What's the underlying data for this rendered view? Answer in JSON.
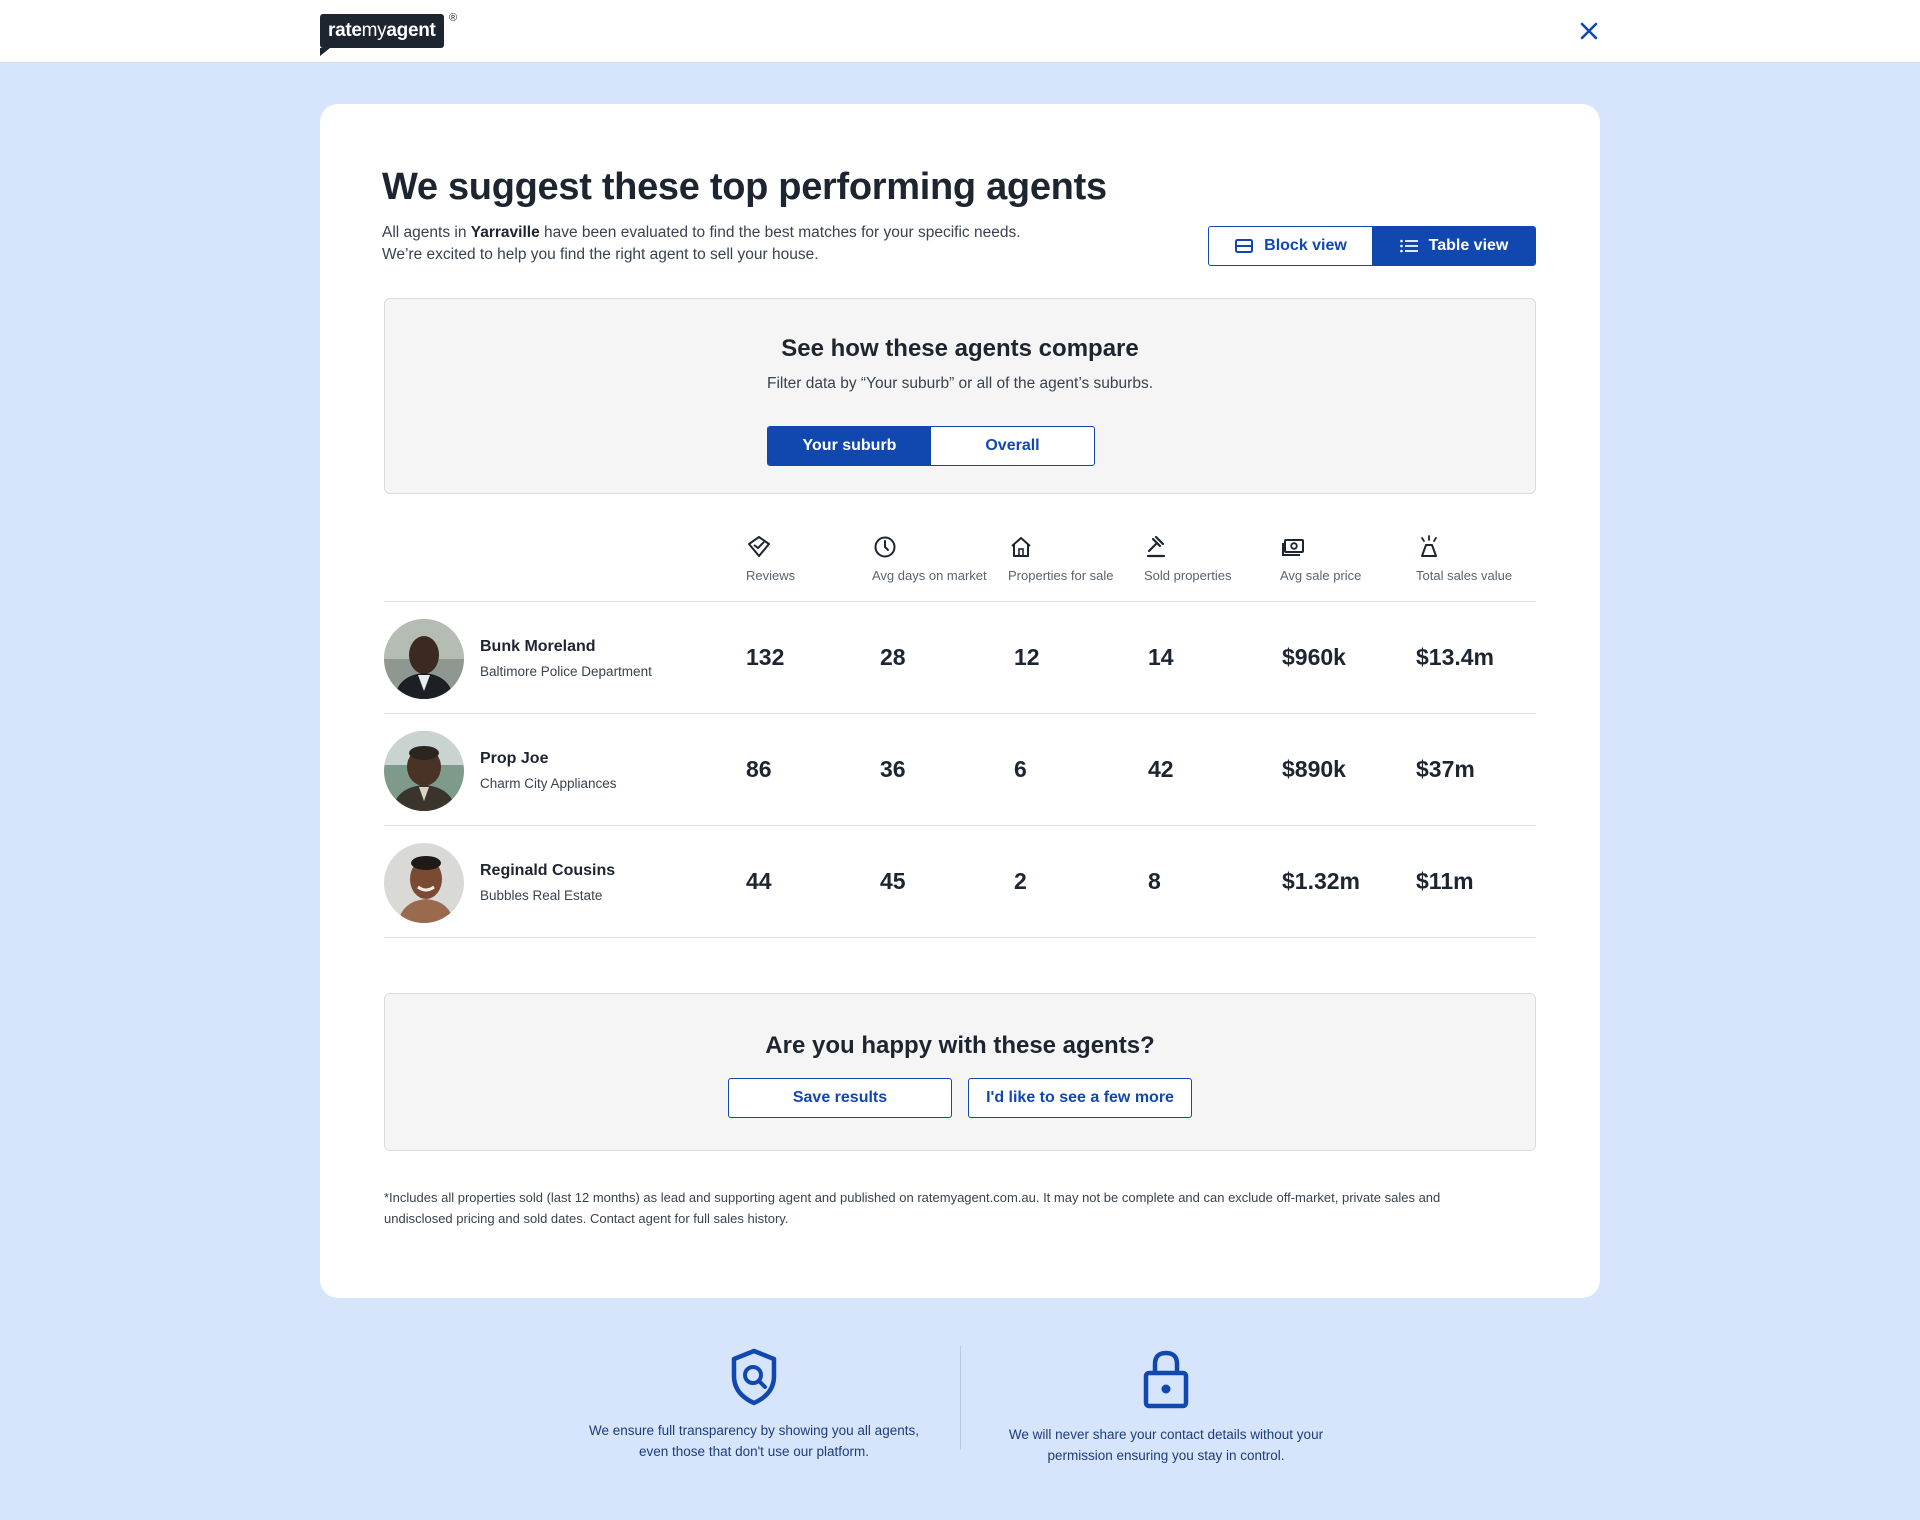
{
  "brand": {
    "logo_rate": "rate",
    "logo_my": "my",
    "logo_agent": "agent",
    "registered": "®"
  },
  "header": {
    "title": "We suggest these top performing agents",
    "intro_1": "All agents in ",
    "suburb": "Yarraville",
    "intro_2": " have been evaluated to find the best matches for your specific needs.",
    "intro_3": "We’re excited to help you find the right agent to sell your house."
  },
  "view_toggle": {
    "block_label": "Block view",
    "table_label": "Table view",
    "active": "table"
  },
  "compare": {
    "title": "See how these agents compare",
    "subtitle": "Filter data by “Your suburb” or all of the agent’s suburbs.",
    "options": [
      "Your suburb",
      "Overall"
    ],
    "active": "Your suburb"
  },
  "columns": [
    {
      "label": "Reviews",
      "icon": "review-badge-icon"
    },
    {
      "label": "Avg days on market",
      "icon": "clock-icon"
    },
    {
      "label": "Properties for sale",
      "icon": "house-icon"
    },
    {
      "label": "Sold properties",
      "icon": "gavel-icon"
    },
    {
      "label": "Avg sale price",
      "icon": "money-icon"
    },
    {
      "label": "Total sales value",
      "icon": "bell-sparkle-icon"
    }
  ],
  "agents": [
    {
      "name": "Bunk Moreland",
      "agency": "Baltimore Police Department",
      "stats": [
        "132",
        "28",
        "12",
        "14",
        "$960k",
        "$13.4m"
      ]
    },
    {
      "name": "Prop Joe",
      "agency": "Charm City Appliances",
      "stats": [
        "86",
        "36",
        "6",
        "42",
        "$890k",
        "$37m"
      ]
    },
    {
      "name": "Reginald Cousins",
      "agency": "Bubbles Real Estate",
      "stats": [
        "44",
        "45",
        "2",
        "8",
        "$1.32m",
        "$11m"
      ]
    }
  ],
  "happy": {
    "title": "Are you happy with these agents?",
    "save_label": "Save results",
    "more_label": "I'd like to see a few more"
  },
  "disclaimer_1": "*Includes all properties sold (last 12 months) as lead and supporting agent and published on ratemyagent.com.au. It may not be complete and can exclude off-market, private sales and",
  "disclaimer_2": "undisclosed pricing and sold dates. Contact agent for full sales history.",
  "trust": [
    {
      "icon": "shield-search-icon",
      "line1": "We ensure full transparency by showing you all agents,",
      "line2": "even those that don't use our platform."
    },
    {
      "icon": "lock-icon",
      "line1": "We will never share your contact details without your",
      "line2": "permission ensuring you stay in control."
    }
  ],
  "colors": {
    "accent": "#1148b0",
    "page_bg": "#d6e4fc",
    "card_bg": "#ffffff",
    "panel_bg": "#f5f5f5",
    "text": "#1d2530"
  }
}
